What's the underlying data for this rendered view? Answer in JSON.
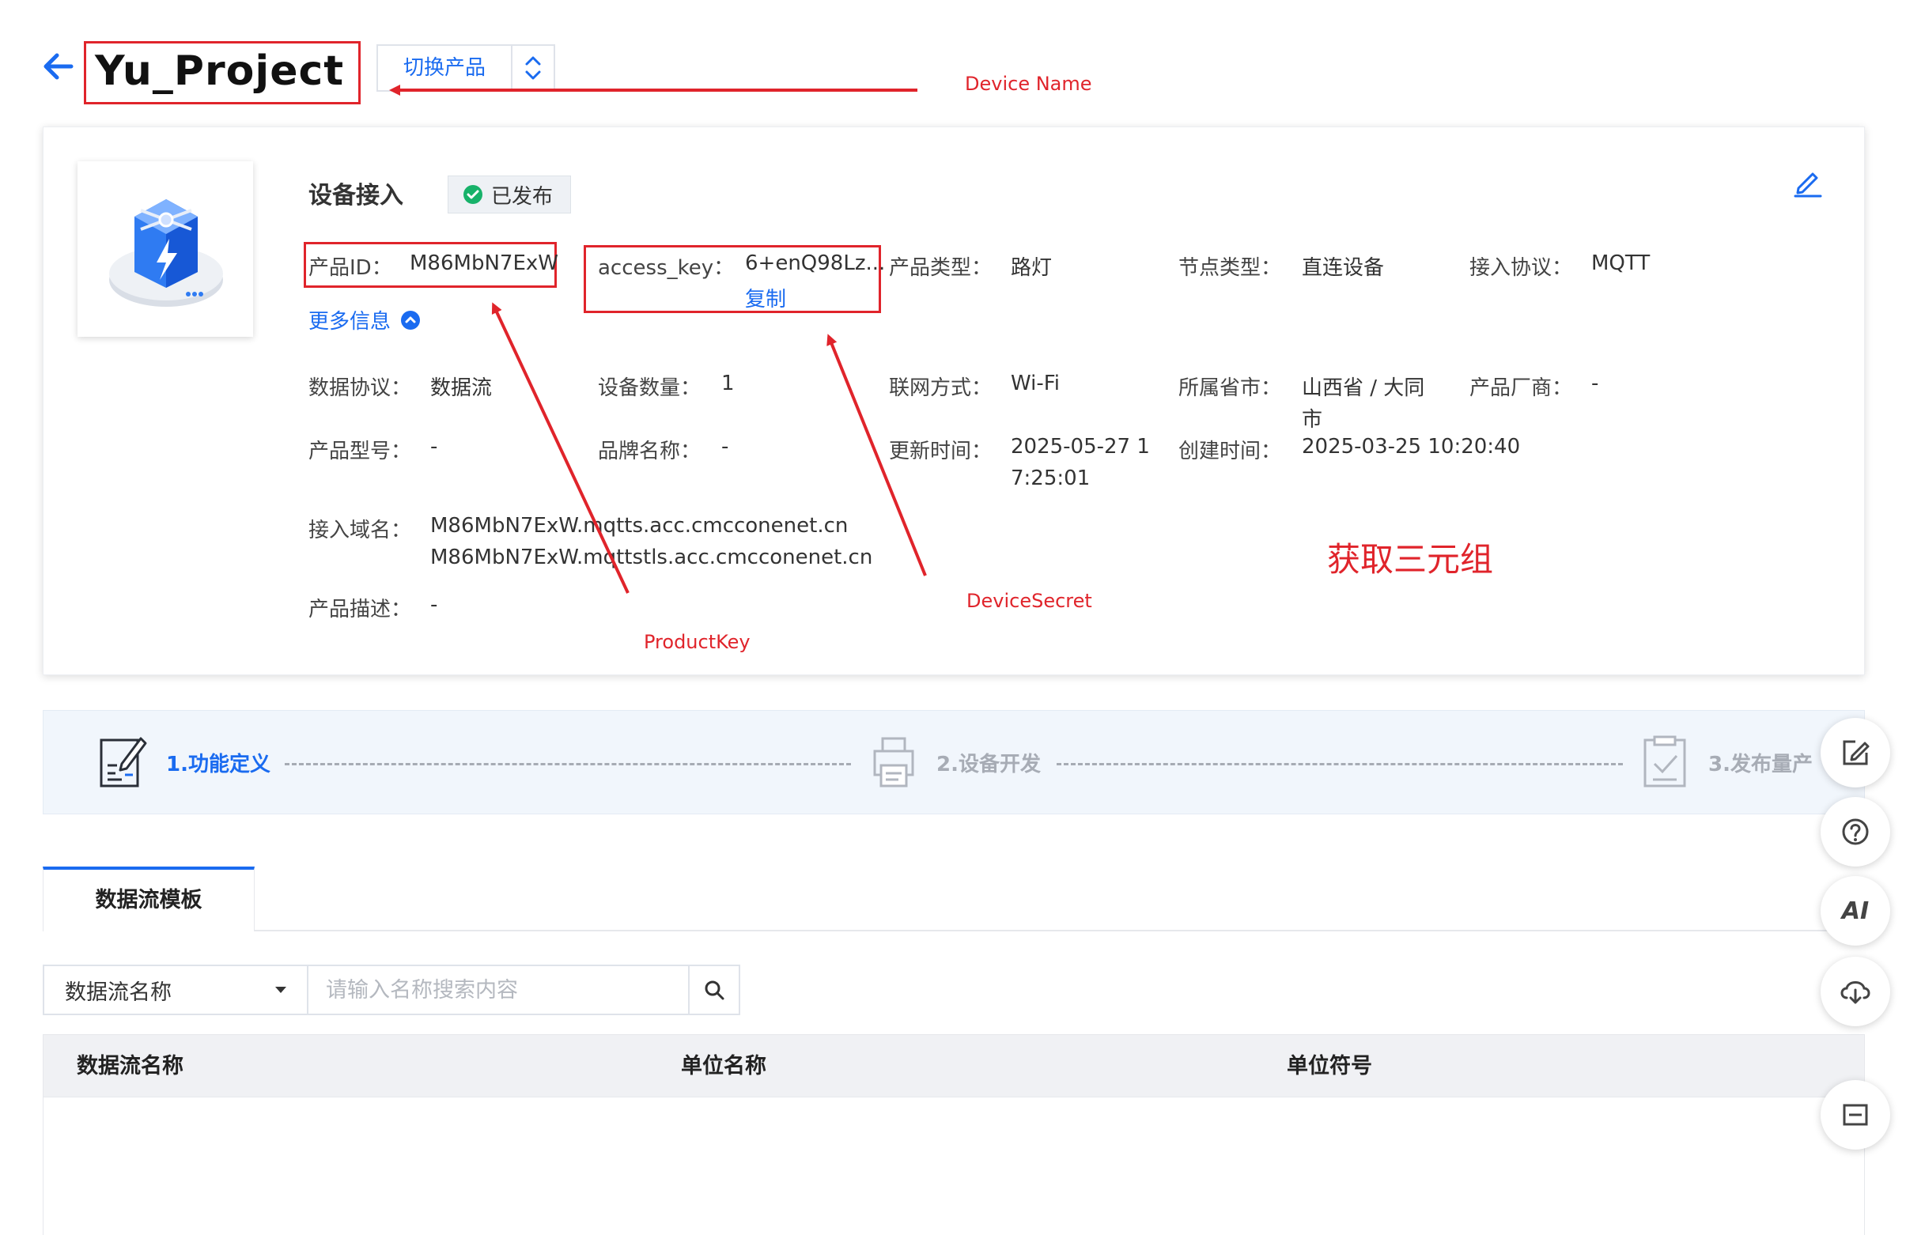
{
  "header": {
    "title": "Yu_Project",
    "switch_label": "切换产品"
  },
  "card": {
    "section_title": "设备接入",
    "status": "已发布",
    "more_info": "更多信息",
    "copy_label": "复制",
    "fields": {
      "product_id": {
        "label": "产品ID：",
        "value": "M86MbN7ExW"
      },
      "access_key": {
        "label": "access_key：",
        "value": "6+enQ98Lz..."
      },
      "product_type": {
        "label": "产品类型：",
        "value": "路灯"
      },
      "node_type": {
        "label": "节点类型：",
        "value": "直连设备"
      },
      "protocol": {
        "label": "接入协议：",
        "value": "MQTT"
      },
      "data_protocol": {
        "label": "数据协议：",
        "value": "数据流"
      },
      "device_count": {
        "label": "设备数量：",
        "value": "1"
      },
      "network": {
        "label": "联网方式：",
        "value": "Wi-Fi"
      },
      "region": {
        "label": "所属省市：",
        "value_line1": "山西省 / 大同",
        "value_line2": "市"
      },
      "vendor": {
        "label": "产品厂商：",
        "value": "-"
      },
      "model": {
        "label": "产品型号：",
        "value": "-"
      },
      "brand": {
        "label": "品牌名称：",
        "value": "-"
      },
      "updated": {
        "label": "更新时间：",
        "value_line1": "2025-05-27 1",
        "value_line2": "7:25:01"
      },
      "created": {
        "label": "创建时间：",
        "value": "2025-03-25 10:20:40"
      },
      "domain": {
        "label": "接入域名：",
        "value_line1": "M86MbN7ExW.mqtts.acc.cmcconenet.cn",
        "value_line2": "M86MbN7ExW.mqttstls.acc.cmcconenet.cn"
      },
      "description": {
        "label": "产品描述：",
        "value": "-"
      }
    }
  },
  "annotations": {
    "device_name": "Device Name",
    "product_key": "ProductKey",
    "device_secret": "DeviceSecret",
    "triple": "获取三元组",
    "color": "#e0242b"
  },
  "steps": [
    {
      "label": "1.功能定义",
      "active": true
    },
    {
      "label": "2.设备开发",
      "active": false
    },
    {
      "label": "3.发布量产",
      "active": false
    }
  ],
  "tabs": [
    {
      "label": "数据流模板",
      "active": true
    }
  ],
  "search": {
    "select_value": "数据流名称",
    "placeholder": "请输入名称搜索内容"
  },
  "table": {
    "columns": [
      "数据流名称",
      "单位名称",
      "单位符号"
    ]
  },
  "floating_tools": {
    "ai_label": "AI",
    "icons": [
      "edit-note-icon",
      "help-icon",
      "ai-icon",
      "cloud-download-icon",
      "collapse-icon"
    ]
  },
  "colors": {
    "accent": "#1a6bf0",
    "success": "#17b26a",
    "annotation": "#e0242b"
  }
}
